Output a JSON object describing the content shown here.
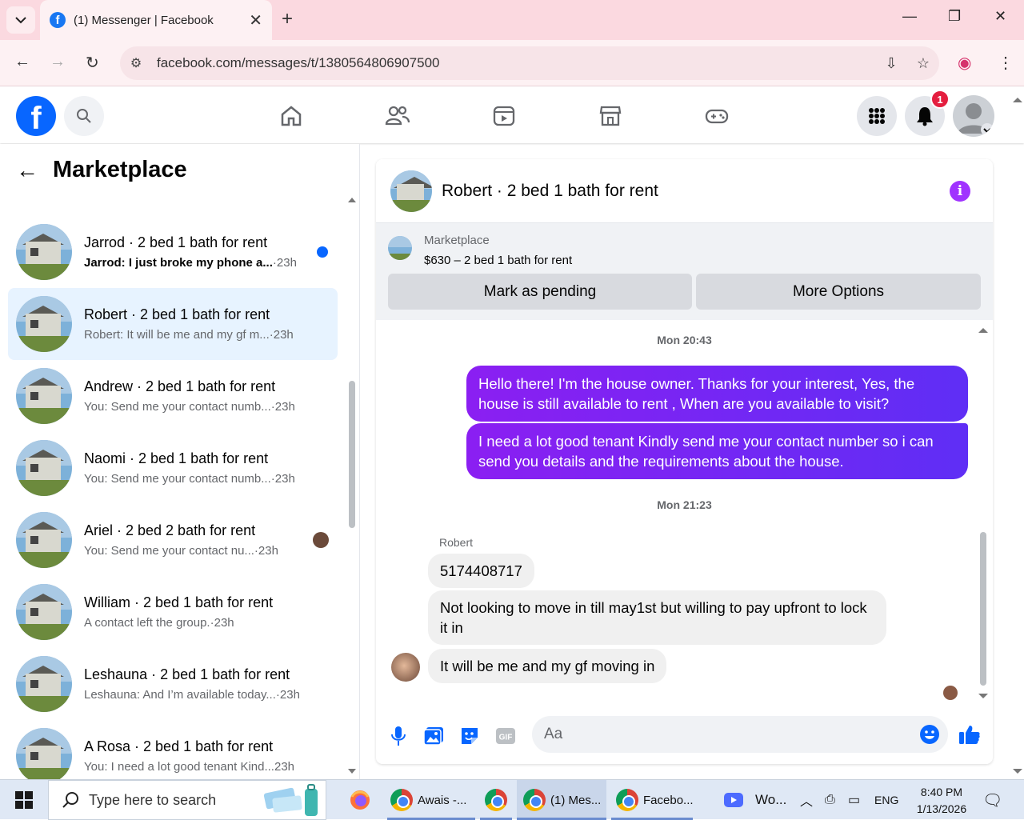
{
  "browser": {
    "tab_title": "(1) Messenger | Facebook",
    "favicon_letter": "f",
    "url": "facebook.com/messages/t/1380564806907500"
  },
  "facebook": {
    "logo_letter": "f",
    "notification_count": "1"
  },
  "sidebar": {
    "title": "Marketplace",
    "conversations": [
      {
        "name": "Jarrod · 2 bed 1 bath for rent",
        "snippet": "Jarrod: I just broke my phone a...",
        "time": "·23h",
        "unread": true
      },
      {
        "name": "Robert · 2 bed 1 bath for rent",
        "snippet": "Robert: It will be me and my gf m...",
        "time": "·23h",
        "active": true
      },
      {
        "name": "Andrew · 2 bed 1 bath for rent",
        "snippet": "You: Send me your contact numb...",
        "time": "·23h"
      },
      {
        "name": "Naomi · 2 bed 1 bath for rent",
        "snippet": "You: Send me your contact numb...",
        "time": "·23h"
      },
      {
        "name": "Ariel · 2 bed 2 bath for rent",
        "snippet": "You: Send me your contact nu...",
        "time": "·23h"
      },
      {
        "name": "William · 2 bed 1 bath for rent",
        "snippet": "A contact left the group.",
        "time": "·23h"
      },
      {
        "name": "Leshauna · 2 bed 1 bath for rent",
        "snippet": "Leshauna: And I’m available today...",
        "time": "·23h"
      },
      {
        "name": "A Rosa · 2 bed 1 bath for rent",
        "snippet": "You: I need a lot good tenant Kind...",
        "time": "23h"
      }
    ]
  },
  "chat": {
    "title": "Robert · 2 bed 1 bath for rent",
    "info_icon": "i",
    "marketplace_label": "Marketplace",
    "listing": "$630 – 2 bed 1 bath for rent",
    "mark_pending": "Mark as pending",
    "more_options": "More Options",
    "timestamp1": "Mon 20:43",
    "out_msg1": "Hello there! I'm the house owner. Thanks for your interest, Yes, the house is still available to rent , When are you available to visit?",
    "out_msg2": "I need a lot good tenant Kindly send me your contact number so i can send you details and the requirements about the house.",
    "timestamp2": "Mon 21:23",
    "sender": "Robert",
    "in_msg1": "5174408717",
    "in_msg2": "Not looking to move in till may1st but willing to pay upfront to lock it in",
    "in_msg3": "It will be me and my gf moving in",
    "composer_placeholder": "Aa"
  },
  "taskbar": {
    "search_placeholder": "Type here to search",
    "item1": "Awais -...",
    "item2": "(1) Mes...",
    "item3": "Facebo...",
    "item4": "Wo...",
    "lang": "ENG",
    "time": "8:40 PM",
    "date": "1/13/2026"
  }
}
